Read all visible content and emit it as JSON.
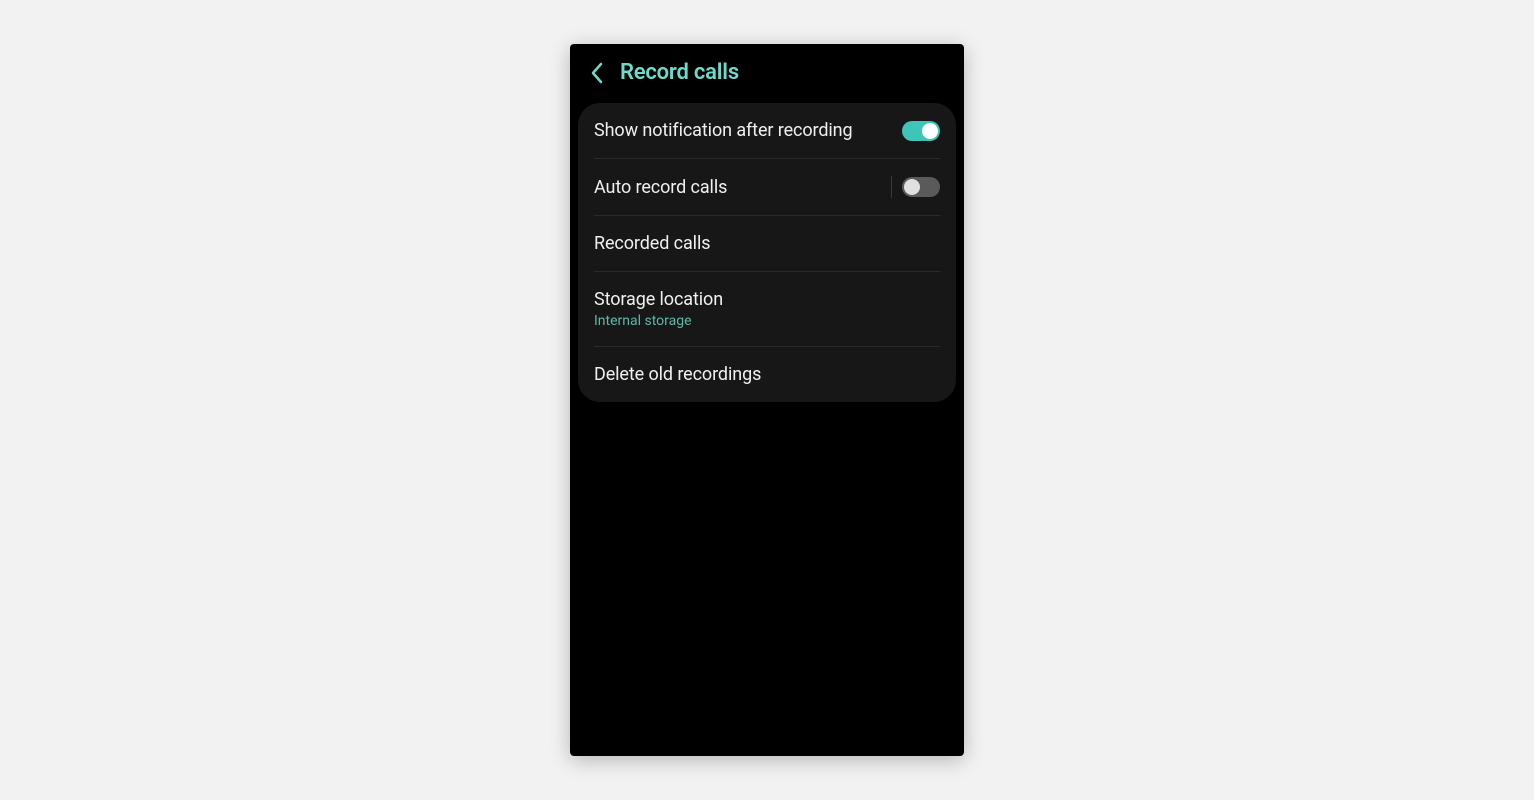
{
  "header": {
    "title": "Record calls"
  },
  "settings": {
    "show_notification": {
      "label": "Show notification after recording",
      "enabled": true
    },
    "auto_record": {
      "label": "Auto record calls",
      "enabled": false
    },
    "recorded_calls": {
      "label": "Recorded calls"
    },
    "storage_location": {
      "label": "Storage location",
      "value": "Internal storage"
    },
    "delete_old": {
      "label": "Delete old recordings"
    }
  },
  "colors": {
    "accent": "#6fd9cc",
    "toggle_on": "#3fc4b8",
    "toggle_off": "#5a5a5a",
    "card_bg": "#171717"
  }
}
